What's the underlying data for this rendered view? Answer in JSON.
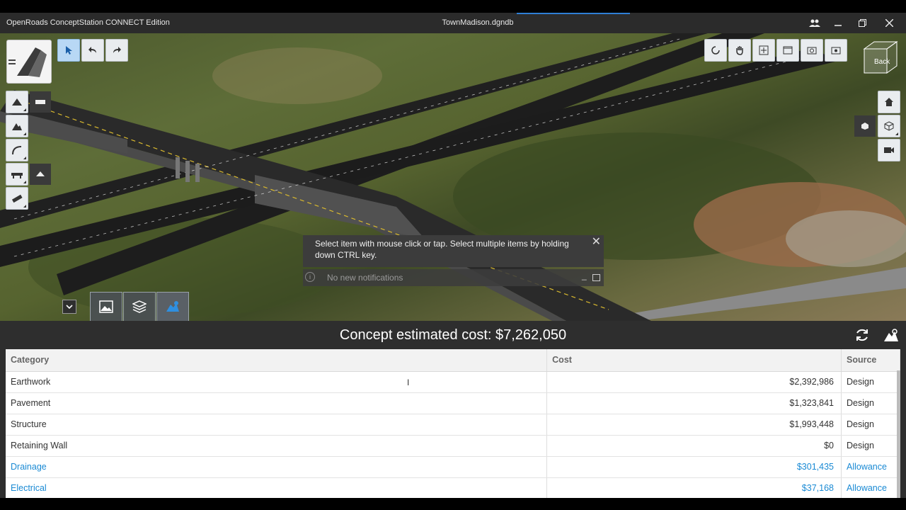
{
  "titlebar": {
    "app_title": "OpenRoads ConceptStation CONNECT Edition",
    "file_title": "TownMadison.dgndb",
    "buttons": [
      "users-icon",
      "minimize-icon",
      "restore-icon",
      "close-icon"
    ]
  },
  "toolbar_top_left": [
    "select-arrow-icon",
    "undo-icon",
    "redo-icon"
  ],
  "toolbar_left": [
    "road-tool-icon",
    "terrain-tool-icon",
    "curve-tool-icon",
    "bridge-tool-icon",
    "measure-tool-icon"
  ],
  "toolbar_top_right": [
    "rotate-view-icon",
    "pan-hand-icon",
    "zoom-extents-icon",
    "window-area-icon",
    "camera-snapshot-icon",
    "camera-settings-icon"
  ],
  "view_cube": {
    "face_label": "Back"
  },
  "toolbar_right": [
    "home-view-icon",
    "cube-view-icon",
    "video-camera-icon"
  ],
  "toast": {
    "message": "Select item with mouse click or tap. Select multiple items by holding down CTRL key.",
    "close": "✕"
  },
  "notifications": {
    "text": "No new notifications"
  },
  "bottom_tabs": [
    "dropdown-chevron-icon",
    "terrain-image-icon",
    "layers-icon",
    "cost-estimate-icon"
  ],
  "cost_panel": {
    "title": "Concept estimated cost: $7,262,050",
    "refresh_icon": "refresh-icon",
    "settings_icon": "cost-settings-icon"
  },
  "cost_table": {
    "headers": [
      "Category",
      "Cost",
      "Source"
    ],
    "rows": [
      {
        "category": "Earthwork",
        "cost": "$2,392,986",
        "source": "Design"
      },
      {
        "category": "Pavement",
        "cost": "$1,323,841",
        "source": "Design"
      },
      {
        "category": "Structure",
        "cost": "$1,993,448",
        "source": "Design"
      },
      {
        "category": "Retaining Wall",
        "cost": "$0",
        "source": "Design"
      },
      {
        "category": "Drainage",
        "cost": "$301,435",
        "source": "Allowance"
      },
      {
        "category": "Electrical",
        "cost": "$37,168",
        "source": "Allowance"
      }
    ]
  },
  "colors": {
    "link": "#1a8ad4",
    "active_tool": "#b8d8f5",
    "accent": "#2f7fd6"
  }
}
